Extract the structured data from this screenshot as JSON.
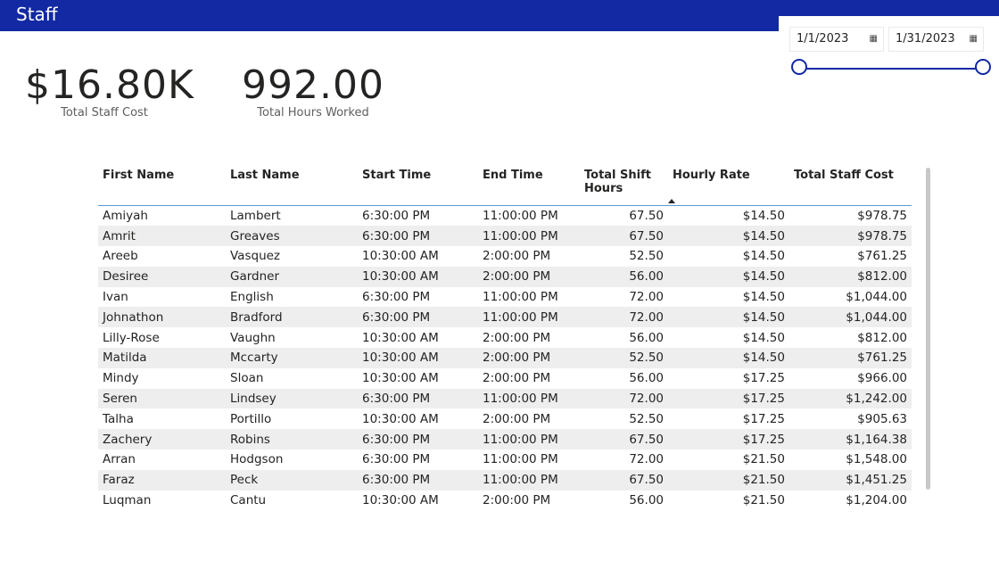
{
  "header": {
    "title": "Staff"
  },
  "colors": {
    "accent": "#1229a3",
    "row_alt": "#eeeeee",
    "header_rule": "#5b9bd5"
  },
  "slicer": {
    "start_date": "1/1/2023",
    "end_date": "1/31/2023",
    "calendar_icon": "calendar-icon"
  },
  "kpis": {
    "total_staff_cost": {
      "value": "$16.80K",
      "label": "Total Staff Cost"
    },
    "total_hours_worked": {
      "value": "992.00",
      "label": "Total Hours Worked"
    }
  },
  "table": {
    "columns": [
      "First Name",
      "Last Name",
      "Start Time",
      "End Time",
      "Total Shift Hours",
      "Hourly Rate",
      "Total Staff Cost"
    ],
    "sorted_column": "Hourly Rate",
    "sort_direction": "ascending",
    "rows": [
      [
        "Amiyah",
        "Lambert",
        "6:30:00 PM",
        "11:00:00 PM",
        "67.50",
        "$14.50",
        "$978.75"
      ],
      [
        "Amrit",
        "Greaves",
        "6:30:00 PM",
        "11:00:00 PM",
        "67.50",
        "$14.50",
        "$978.75"
      ],
      [
        "Areeb",
        "Vasquez",
        "10:30:00 AM",
        "2:00:00 PM",
        "52.50",
        "$14.50",
        "$761.25"
      ],
      [
        "Desiree",
        "Gardner",
        "10:30:00 AM",
        "2:00:00 PM",
        "56.00",
        "$14.50",
        "$812.00"
      ],
      [
        "Ivan",
        "English",
        "6:30:00 PM",
        "11:00:00 PM",
        "72.00",
        "$14.50",
        "$1,044.00"
      ],
      [
        "Johnathon",
        "Bradford",
        "6:30:00 PM",
        "11:00:00 PM",
        "72.00",
        "$14.50",
        "$1,044.00"
      ],
      [
        "Lilly-Rose",
        "Vaughn",
        "10:30:00 AM",
        "2:00:00 PM",
        "56.00",
        "$14.50",
        "$812.00"
      ],
      [
        "Matilda",
        "Mccarty",
        "10:30:00 AM",
        "2:00:00 PM",
        "52.50",
        "$14.50",
        "$761.25"
      ],
      [
        "Mindy",
        "Sloan",
        "10:30:00 AM",
        "2:00:00 PM",
        "56.00",
        "$17.25",
        "$966.00"
      ],
      [
        "Seren",
        "Lindsey",
        "6:30:00 PM",
        "11:00:00 PM",
        "72.00",
        "$17.25",
        "$1,242.00"
      ],
      [
        "Talha",
        "Portillo",
        "10:30:00 AM",
        "2:00:00 PM",
        "52.50",
        "$17.25",
        "$905.63"
      ],
      [
        "Zachery",
        "Robins",
        "6:30:00 PM",
        "11:00:00 PM",
        "67.50",
        "$17.25",
        "$1,164.38"
      ],
      [
        "Arran",
        "Hodgson",
        "6:30:00 PM",
        "11:00:00 PM",
        "72.00",
        "$21.50",
        "$1,548.00"
      ],
      [
        "Faraz",
        "Peck",
        "6:30:00 PM",
        "11:00:00 PM",
        "67.50",
        "$21.50",
        "$1,451.25"
      ],
      [
        "Luqman",
        "Cantu",
        "10:30:00 AM",
        "2:00:00 PM",
        "56.00",
        "$21.50",
        "$1,204.00"
      ]
    ]
  }
}
